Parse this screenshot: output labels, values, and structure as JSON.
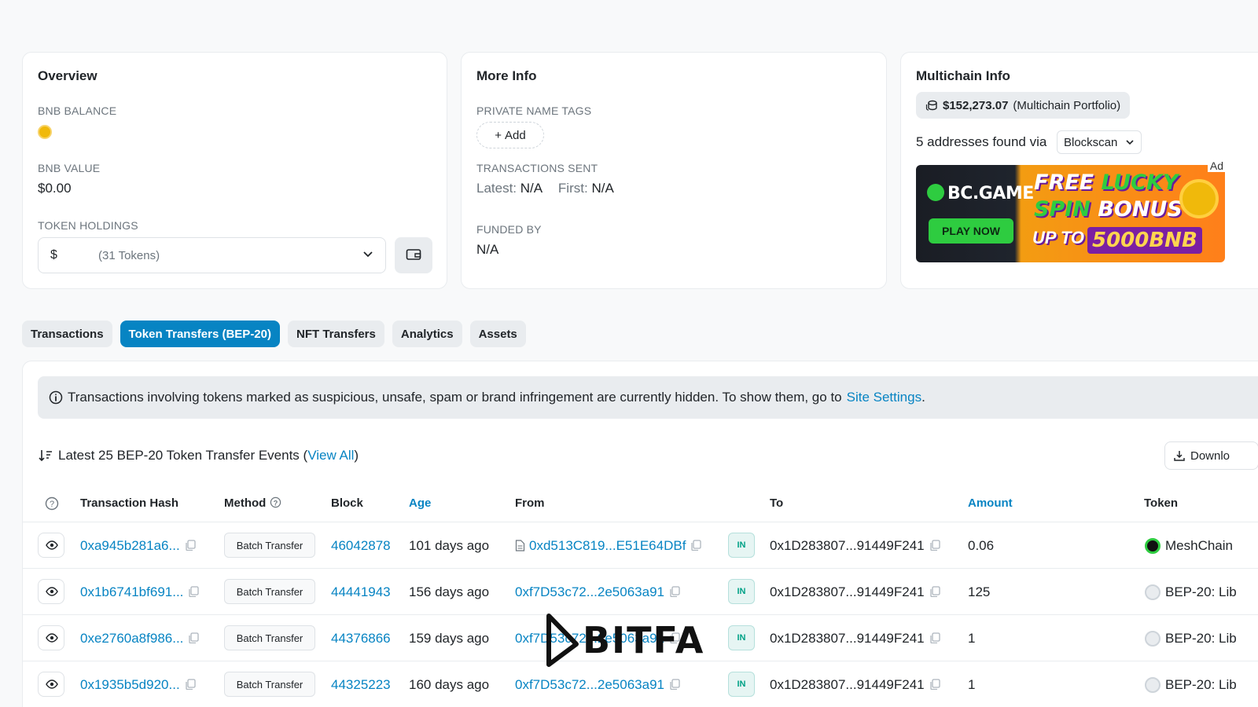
{
  "overview": {
    "title": "Overview",
    "bnb_balance_label": "BNB BALANCE",
    "bnb_value_label": "BNB VALUE",
    "bnb_value": "$0.00",
    "token_holdings_label": "TOKEN HOLDINGS",
    "token_holdings_currency": "$",
    "token_holdings_count": "(31 Tokens)"
  },
  "more_info": {
    "title": "More Info",
    "private_tags_label": "PRIVATE NAME TAGS",
    "add_label": "Add",
    "tx_sent_label": "TRANSACTIONS SENT",
    "latest_label": "Latest:",
    "latest_value": "N/A",
    "first_label": "First:",
    "first_value": "N/A",
    "funded_by_label": "FUNDED BY",
    "funded_by_value": "N/A"
  },
  "multichain": {
    "title": "Multichain Info",
    "portfolio_value": "$152,273.07",
    "portfolio_label": "(Multichain Portfolio)",
    "addresses_found": "5 addresses found via",
    "blockscan_option": "Blockscan",
    "ad_badge": "Ad",
    "ad": {
      "brand": "BC.GAME",
      "button": "PLAY NOW",
      "line1a": "FREE",
      "line1b": "LUCKY",
      "line2a": "SPIN",
      "line2b": "BONUS",
      "upto": "UP TO",
      "amount": "5000BNB"
    }
  },
  "tabs": [
    {
      "label": "Transactions",
      "active": false
    },
    {
      "label": "Token Transfers (BEP-20)",
      "active": true
    },
    {
      "label": "NFT Transfers",
      "active": false
    },
    {
      "label": "Analytics",
      "active": false
    },
    {
      "label": "Assets",
      "active": false
    }
  ],
  "notice": {
    "text": "Transactions involving tokens marked as suspicious, unsafe, spam or brand infringement are currently hidden. To show them, go to",
    "link": "Site Settings",
    "end": "."
  },
  "latest": {
    "text": "Latest 25 BEP-20 Token Transfer Events (",
    "link": "View All",
    "end": ")"
  },
  "download_label": "Downlo",
  "columns": {
    "tx_hash": "Transaction Hash",
    "method": "Method",
    "block": "Block",
    "age": "Age",
    "from": "From",
    "to": "To",
    "amount": "Amount",
    "token": "Token"
  },
  "rows": [
    {
      "hash": "0xa945b281a6...",
      "method": "Batch Transfer",
      "block": "46042878",
      "age": "101 days ago",
      "from": "0xd513C819...E51E64DBf",
      "dir": "IN",
      "to": "0x1D283807...91449F241",
      "amount": "0.06",
      "token": "MeshChain"
    },
    {
      "hash": "0x1b6741bf691...",
      "method": "Batch Transfer",
      "block": "44441943",
      "age": "156 days ago",
      "from": "0xf7D53c72...2e5063a91",
      "dir": "IN",
      "to": "0x1D283807...91449F241",
      "amount": "125",
      "token": "BEP-20: Lib"
    },
    {
      "hash": "0xe2760a8f986...",
      "method": "Batch Transfer",
      "block": "44376866",
      "age": "159 days ago",
      "from": "0xf7D53c72...2e5063a91",
      "dir": "IN",
      "to": "0x1D283807...91449F241",
      "amount": "1",
      "token": "BEP-20: Lib"
    },
    {
      "hash": "0x1935b5d920...",
      "method": "Batch Transfer",
      "block": "44325223",
      "age": "160 days ago",
      "from": "0xf7D53c72...2e5063a91",
      "dir": "IN",
      "to": "0x1D283807...91449F241",
      "amount": "1",
      "token": "BEP-20: Lib"
    }
  ],
  "watermark": "BITFA",
  "colors": {
    "accent": "#0784c3",
    "in_badge": "#00a186",
    "bnb": "#f0b90b"
  }
}
